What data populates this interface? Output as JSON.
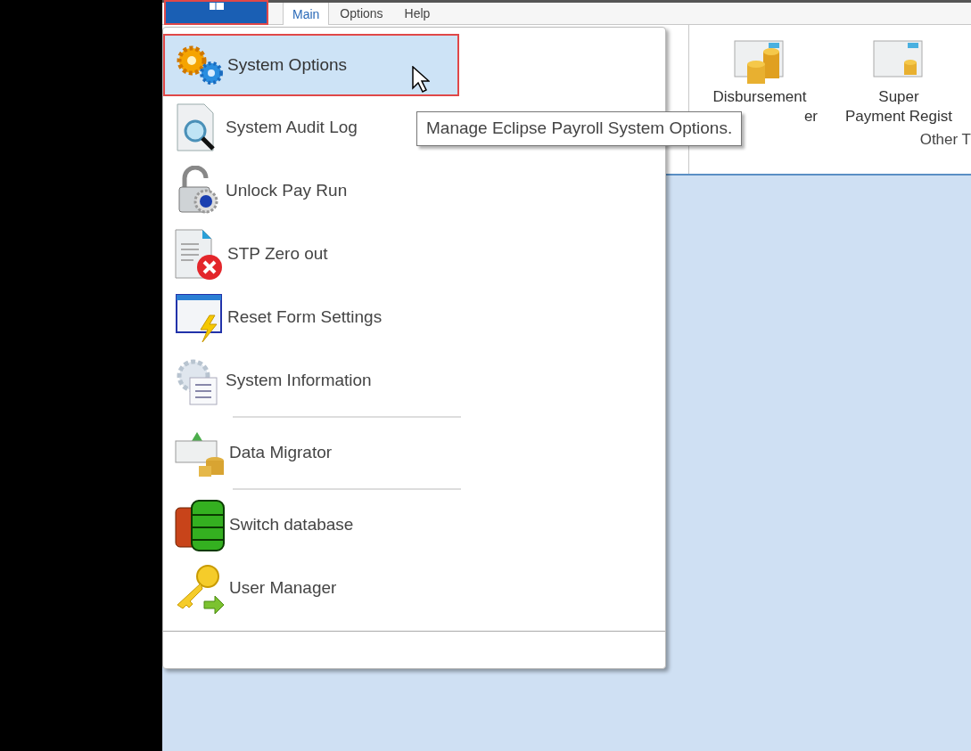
{
  "tabs": [
    {
      "label": "Main",
      "selected": true
    },
    {
      "label": "Options",
      "selected": false
    },
    {
      "label": "Help",
      "selected": false
    }
  ],
  "ribbon": {
    "buttons": [
      {
        "lines": [
          "Disbursement",
          "er"
        ]
      },
      {
        "lines": [
          "Super",
          "Payment Regist"
        ]
      }
    ],
    "group_label": "Other T"
  },
  "menu": {
    "items": [
      {
        "kind": "item",
        "label": "System Options",
        "selected": true
      },
      {
        "kind": "item",
        "label": "System Audit Log",
        "selected": false
      },
      {
        "kind": "item",
        "label": "Unlock Pay Run",
        "selected": false
      },
      {
        "kind": "item",
        "label": "STP Zero out",
        "selected": false
      },
      {
        "kind": "item",
        "label": "Reset Form Settings",
        "selected": false
      },
      {
        "kind": "item",
        "label": "System Information",
        "selected": false
      },
      {
        "kind": "separator"
      },
      {
        "kind": "item",
        "label": "Data Migrator",
        "selected": false
      },
      {
        "kind": "separator"
      },
      {
        "kind": "item",
        "label": "Switch database",
        "selected": false
      },
      {
        "kind": "item",
        "label": "User Manager",
        "selected": false
      }
    ]
  },
  "tooltip": "Manage Eclipse Payroll System Options."
}
